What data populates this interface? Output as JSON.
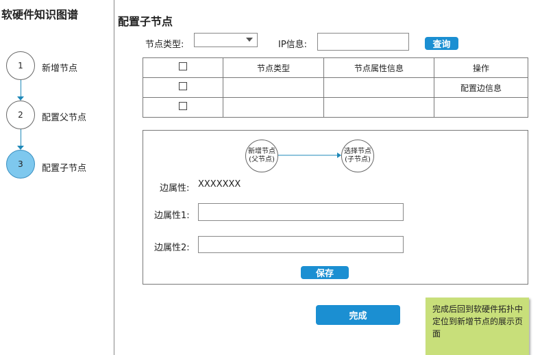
{
  "sidebar": {
    "title": "软硬件知识图谱",
    "steps": [
      {
        "number": "1",
        "label": "新增节点"
      },
      {
        "number": "2",
        "label": "配置父节点"
      },
      {
        "number": "3",
        "label": "配置子节点"
      }
    ],
    "active_step": 3
  },
  "main": {
    "title": "配置子节点",
    "filters": {
      "node_type_label": "节点类型:",
      "node_type_value": "",
      "ip_label": "IP信息:",
      "ip_value": "",
      "query_button": "查询"
    },
    "table": {
      "headers": [
        "",
        "节点类型",
        "节点属性信息",
        "操作"
      ],
      "rows": [
        {
          "type": "",
          "attrs": "",
          "action": "配置边信息"
        },
        {
          "type": "",
          "attrs": "",
          "action": ""
        }
      ]
    },
    "edge_panel": {
      "parent_node": "新增节点(父节点)",
      "child_node": "选择节点(子节点)",
      "edge_attr_label": "边属性:",
      "edge_attr_value": "XXXXXXX",
      "attr1_label": "边属性1:",
      "attr1_value": "",
      "attr2_label": "边属性2:",
      "attr2_value": "",
      "save_button": "保存"
    },
    "finish_button": "完成",
    "note": "完成后回到软硬件拓扑中定位到新增节点的展示页面"
  },
  "colors": {
    "accent": "#1b8fd2",
    "active_step": "#7ec8ee",
    "connector": "#1e88b8",
    "note_bg": "#c8df7a"
  }
}
